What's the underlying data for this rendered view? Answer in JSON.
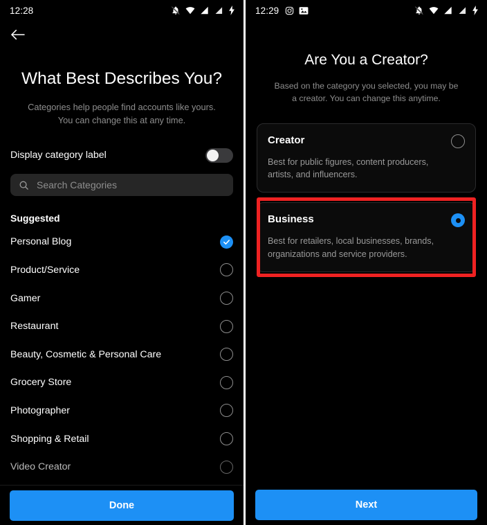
{
  "left": {
    "statusbar": {
      "time": "12:28",
      "right_icons": [
        "notifications-off-icon",
        "wifi-icon",
        "signal-icon",
        "signal-no-sim-icon",
        "battery-charging-icon"
      ]
    },
    "back_icon": "back-arrow-icon",
    "title": "What Best Describes You?",
    "subtitle": "Categories help people find accounts like yours. You can change this at any time.",
    "toggle": {
      "label": "Display category label",
      "state": "off"
    },
    "search": {
      "placeholder": "Search Categories",
      "icon": "search-icon",
      "value": ""
    },
    "section_header": "Suggested",
    "categories": [
      {
        "label": "Personal Blog",
        "selected": true
      },
      {
        "label": "Product/Service",
        "selected": false
      },
      {
        "label": "Gamer",
        "selected": false
      },
      {
        "label": "Restaurant",
        "selected": false
      },
      {
        "label": "Beauty, Cosmetic & Personal Care",
        "selected": false
      },
      {
        "label": "Grocery Store",
        "selected": false
      },
      {
        "label": "Photographer",
        "selected": false
      },
      {
        "label": "Shopping & Retail",
        "selected": false
      },
      {
        "label": "Video Creator",
        "selected": false
      }
    ],
    "cta_label": "Done"
  },
  "right": {
    "statusbar": {
      "time": "12:29",
      "left_icons": [
        "instagram-icon",
        "image-icon"
      ],
      "right_icons": [
        "notifications-off-icon",
        "wifi-icon",
        "signal-icon",
        "signal-no-sim-icon",
        "battery-charging-icon"
      ]
    },
    "title": "Are You a Creator?",
    "subtitle": "Based on the category you selected, you may be a creator. You can change this anytime.",
    "options": [
      {
        "title": "Creator",
        "description": "Best for public figures, content producers, artists, and influencers.",
        "selected": false,
        "highlighted": false
      },
      {
        "title": "Business",
        "description": "Best for retailers, local businesses, brands, organizations and service providers.",
        "selected": true,
        "highlighted": true
      }
    ],
    "cta_label": "Next"
  },
  "colors": {
    "accent": "#1d90f5",
    "highlight": "#ef2222",
    "muted_text": "#8e8e8e",
    "background": "#000000"
  }
}
